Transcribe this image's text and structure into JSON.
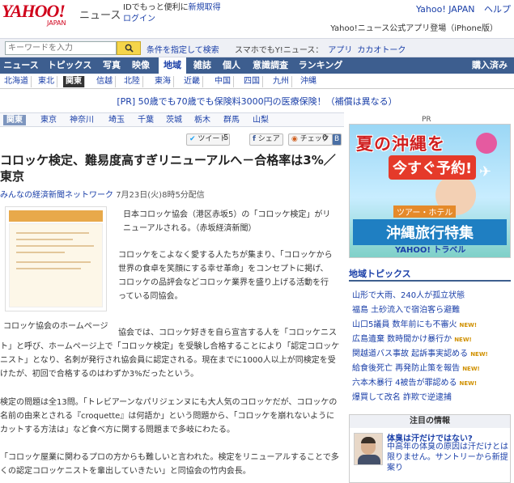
{
  "header": {
    "logo": "YAHOO!",
    "logo_sub": "JAPAN",
    "section": "ニュース",
    "id_promo": "IDでもっと便利に",
    "register": "新規取得",
    "login": "ログイン",
    "yahoo_japan": "Yahoo! JAPAN",
    "help": "ヘルプ",
    "app_promo": "Yahoo!ニュース公式アプリ登場（iPhone版）"
  },
  "search": {
    "placeholder": "キーワードを入力",
    "button_icon": "search-icon",
    "advanced": "条件を指定して検索",
    "sumaho_label": "スマホでもY!ニュース：",
    "app": "アプリ",
    "kakao": "カカオトーク"
  },
  "main_nav": {
    "items": [
      "ニュース",
      "トピックス",
      "写真",
      "映像",
      "地域",
      "雑誌",
      "個人",
      "意識調査",
      "ランキング"
    ],
    "active": "地域",
    "right": "購入済み"
  },
  "sub_nav": {
    "items": [
      "北海道",
      "東北",
      "関東",
      "信越",
      "北陸",
      "東海",
      "近畿",
      "中国",
      "四国",
      "九州",
      "沖縄"
    ],
    "active": "関東"
  },
  "pr_line": "[PR] 50歳でも70歳でも保険料3000円の医療保険！（補償は異なる）",
  "region_nav": {
    "items": [
      "関東",
      "東京",
      "神奈川",
      "埼玉",
      "千葉",
      "茨城",
      "栃木",
      "群馬",
      "山梨"
    ],
    "active": "関東"
  },
  "social": {
    "tweet": "ツイート",
    "tweet_count": "5",
    "share": "シェア",
    "check": "チェック",
    "count2": "0"
  },
  "article": {
    "title": "コロッケ検定、難易度高すぎリニューアルへ－合格率は3%／東京",
    "source": "みんなの経済新聞ネットワーク",
    "date": "7月23日(火)8時5分配信",
    "caption": "コロッケ協会のホームページ",
    "p1": "日本コロッケ協会（港区赤坂5）の「コロッケ検定」がリニューアルされる。（赤坂経済新聞）",
    "p2": "コロッケをこよなく愛する人たちが集まり、「コロッケから世界の食卓を笑顔にする幸せ革命」をコンセプトに掲げ、コロッケの品評会などコロッケ業界を盛り上げる活動を行っている同協会。",
    "p3": "協会では、コロッケ好きを自ら宣言する人を「コロッケニスト」と呼び、ホームページ上で「コロッケ検定」を受験し合格することにより「認定コロッケニスト」となり、名刺が発行され協会員に認定される。現在までに1000人以上が同検定を受けたが、初回で合格するのはわずか3%だったという。",
    "p4": "検定の問題は全13問。「トレビアーンなパリジェンヌにも大人気のコロッケだが、コロッケの名前の由来とされる『croquette』は何語か」という問題から、「コロッケを崩れないようにカットする方法は」など食べ方に関する問題まで多岐にわたる。",
    "p5": "「コロッケ屋業に関わるプロの方からも難しいと言われた。検定をリニューアルすることで多くの認定コロッケニストを輩出していきたい」と同協会の竹内会長。"
  },
  "ad": {
    "pr": "PR",
    "title": "夏の沖縄を",
    "sub": "今すぐ予約!",
    "tour": "ツアー・ホテル",
    "special": "沖縄旅行特集",
    "brand": "YAHOO! トラベル"
  },
  "topics": {
    "heading": "地域トピックス",
    "items": [
      {
        "text": "山形で大雨、240人が孤立状態",
        "new": false
      },
      {
        "text": "福島 土砂流入で宿泊客ら避難",
        "new": false
      },
      {
        "text": "山口5議員 数年前にも不審火",
        "new": true
      },
      {
        "text": "広島遺棄 数時間かけ暴行か",
        "new": true
      },
      {
        "text": "関越道バス事故 起訴事実認める",
        "new": true
      },
      {
        "text": "給食後死亡 再発防止策を報告",
        "new": true
      },
      {
        "text": "六本木暴行 4被告が罪認める",
        "new": true
      },
      {
        "text": "爆買して改名 詐欺で逆逮捕",
        "new": false
      }
    ],
    "new_label": "NEW!"
  },
  "attention": {
    "heading": "注目の情報",
    "title": "体臭は汗だけではない?",
    "text": "中高年の体臭の原因は汗だけとは限りません。サントリーから新提案り"
  }
}
